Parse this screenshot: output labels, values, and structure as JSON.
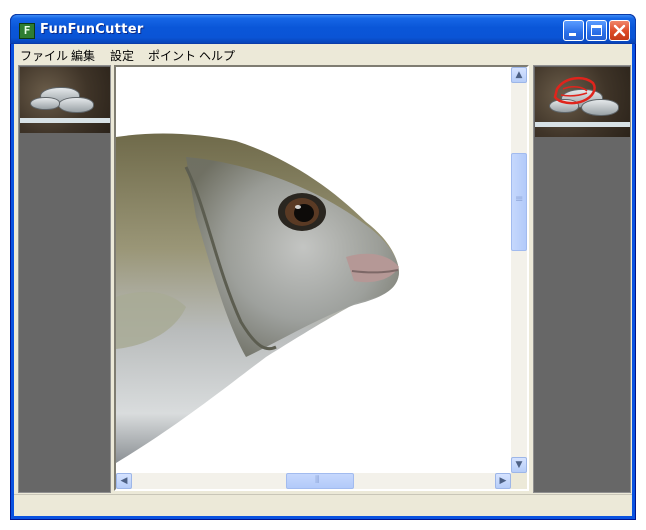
{
  "window": {
    "title": "FunFunCutter",
    "app_icon_letter": "F"
  },
  "menu": {
    "items": [
      {
        "label": "ファイル"
      },
      {
        "label": "編集"
      },
      {
        "label": "設定"
      },
      {
        "label": "ポイント"
      },
      {
        "label": "ヘルプ"
      }
    ]
  },
  "colors": {
    "title_bar": "#0a54d6",
    "panel_bg": "#676767",
    "client_bg": "#ece9d8",
    "selection_outline": "#e0241c"
  },
  "left_panel": {
    "thumbnail": "fish-photo-thumbnail"
  },
  "right_panel": {
    "thumbnail": "fish-photo-thumbnail-with-selection"
  },
  "canvas": {
    "image": "cutout-fish-head"
  },
  "scrollbars": {
    "up_arrow": "▲",
    "down_arrow": "▼",
    "left_arrow": "◀",
    "right_arrow": "▶",
    "grip": "≡",
    "grip_h": "⦀"
  },
  "icons": [
    "minimize-icon",
    "maximize-icon",
    "close-icon",
    "app-icon"
  ]
}
